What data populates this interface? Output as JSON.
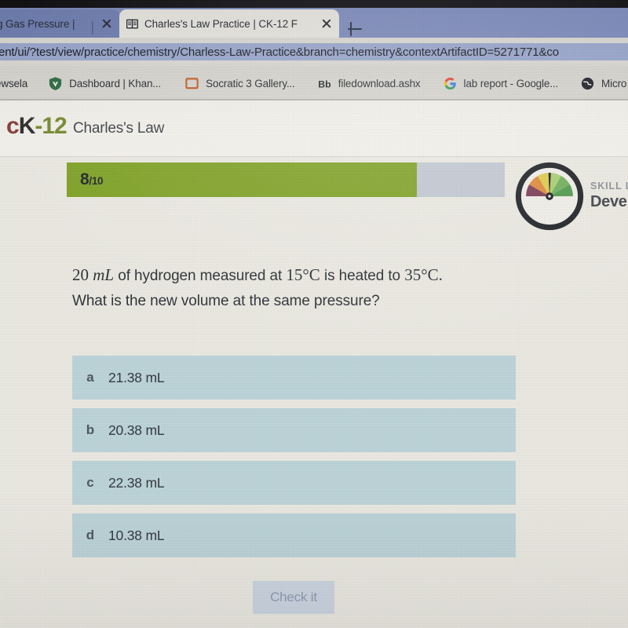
{
  "browser": {
    "tabs": [
      {
        "title": "ting Gas Pressure |",
        "favicon": "none",
        "active": false,
        "close_label": "×"
      },
      {
        "title": "Charles's Law Practice | CK-12 F",
        "favicon": "book-icon",
        "active": true,
        "close_label": "×"
      }
    ],
    "new_tab_label": "+",
    "address_bar": {
      "value": "ent/ui/?test/view/practice/chemistry/Charless-Law-Practice&branch=chemistry&contextArtifactID=5271771&co",
      "selected": true
    },
    "bookmarks": [
      {
        "label": "ewsela",
        "icon": "none"
      },
      {
        "label": "Dashboard | Khan...",
        "icon": "khan-shield-icon"
      },
      {
        "label": "Socratic 3 Gallery...",
        "icon": "orange-square-icon"
      },
      {
        "label": "filedownload.ashx",
        "icon": "blackboard-bb-icon"
      },
      {
        "label": "lab report - Google...",
        "icon": "google-g-icon"
      },
      {
        "label": "Micro",
        "icon": "globe-icon"
      }
    ]
  },
  "ck12": {
    "logo": {
      "part1": "c",
      "part2": "K-12",
      "part3": ""
    },
    "logo_text": {
      "c": "c",
      "k": "K",
      "num": "-12"
    },
    "page_title": "Charles's Law",
    "progress": {
      "current": "8",
      "separator": "/",
      "total": "10",
      "percent": 80
    },
    "skill": {
      "label": "SKILL LEVEL",
      "value": "Develo"
    },
    "question": {
      "line1_pre": "20",
      "line1_unit": "mL",
      "line1_mid": "of hydrogen measured at",
      "line1_temp1": "15°C",
      "line1_mid2": "is heated to",
      "line1_temp2": "35°C",
      "line1_end": ".",
      "line2": "What is the new volume at the same pressure?"
    },
    "options": [
      {
        "letter": "a",
        "text": "21.38 mL"
      },
      {
        "letter": "b",
        "text": "20.38 mL"
      },
      {
        "letter": "c",
        "text": "22.38 mL"
      },
      {
        "letter": "d",
        "text": "10.38 mL"
      }
    ],
    "check_button": {
      "label": "Check it",
      "disabled": true
    }
  },
  "colors": {
    "tabstrip": "#7d8cbf",
    "active_tab": "#eceae4",
    "url_selection": "#9aa8d0",
    "progress_green": "#7fa224",
    "progress_track": "#c3c8d2",
    "option_bg": "#bcd4da",
    "logo_red": "#8a3a34",
    "logo_dark": "#2b2b2b",
    "logo_green": "#77892f",
    "check_disabled_bg": "#ccd6e2",
    "check_disabled_fg": "#8e9bb2"
  }
}
